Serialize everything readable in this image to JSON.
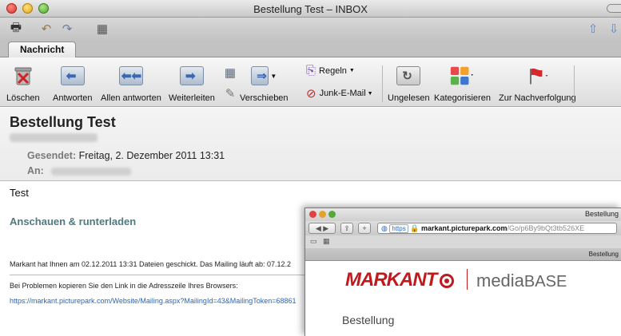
{
  "window": {
    "title": "Bestellung Test – INBOX"
  },
  "tabs": [
    {
      "label": "Nachricht"
    }
  ],
  "ribbon": {
    "delete": "Löschen",
    "reply": "Antworten",
    "reply_all": "Allen antworten",
    "forward": "Weiterleiten",
    "move": "Verschieben",
    "rules": "Regeln",
    "junk": "Junk-E-Mail",
    "unread": "Ungelesen",
    "categorize": "Kategorisieren",
    "follow_up": "Zur Nachverfolgung"
  },
  "message": {
    "subject": "Bestellung Test",
    "sent_label": "Gesendet:",
    "sent_value": "Freitag, 2. Dezember 2011 13:31",
    "to_label": "An:",
    "body_text": "Test",
    "heading": "Anschauen & runterladen",
    "line1": "Markant hat Ihnen am 02.12.2011 13:31 Dateien geschickt. Das Mailing läuft ab: 07.12.2",
    "line2": "Bei Problemen kopieren Sie den Link in die Adresszeile Ihres Browsers:",
    "link": "https://markant.picturepark.com/Website/Mailing.aspx?MailingId=43&MailingToken=68861"
  },
  "browser": {
    "title": "Bestellung",
    "url_scheme": "https",
    "url_domain": "markant.picturepark.com",
    "url_path": "/Go/p6By9bQt3tb526XE",
    "tab_title": "Bestellung",
    "logo_text": "MARKANT",
    "media_text_a": "media",
    "media_text_b": "BASE",
    "page_heading": "Bestellung"
  },
  "colors": {
    "accent_link": "#2a66b5",
    "brand_red": "#c01a1e",
    "heading_teal": "#4e7a80"
  }
}
